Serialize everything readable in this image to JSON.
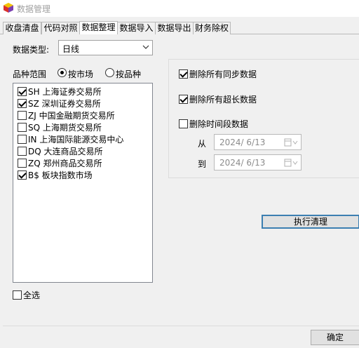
{
  "window": {
    "title": "数据管理"
  },
  "tabs": [
    {
      "label": "收盘清盘",
      "active": false
    },
    {
      "label": "代码对照",
      "active": false
    },
    {
      "label": "数据整理",
      "active": true
    },
    {
      "label": "数据导入",
      "active": false
    },
    {
      "label": "数据导出",
      "active": false
    },
    {
      "label": "财务除权",
      "active": false
    }
  ],
  "data_type": {
    "label": "数据类型:",
    "value": "日线"
  },
  "variety_range": {
    "label": "品种范围",
    "options": [
      {
        "label": "按市场",
        "selected": true
      },
      {
        "label": "按品种",
        "selected": false
      }
    ]
  },
  "markets": [
    {
      "label": "SH 上海证券交易所",
      "checked": true
    },
    {
      "label": "SZ 深圳证券交易所",
      "checked": true
    },
    {
      "label": "ZJ 中国金融期货交易所",
      "checked": false
    },
    {
      "label": "SQ 上海期货交易所",
      "checked": false
    },
    {
      "label": "IN 上海国际能源交易中心",
      "checked": false
    },
    {
      "label": "DQ 大连商品交易所",
      "checked": false
    },
    {
      "label": "ZQ 郑州商品交易所",
      "checked": false
    },
    {
      "label": "B$ 板块指数市场",
      "checked": true
    }
  ],
  "select_all": {
    "label": "全选",
    "checked": false
  },
  "cleanup_options": {
    "delete_sync": {
      "label": "删除所有同步数据",
      "checked": true
    },
    "delete_overlong": {
      "label": "删除所有超长数据",
      "checked": true
    },
    "delete_period": {
      "label": "删除时间段数据",
      "checked": false
    }
  },
  "date_range": {
    "from_label": "从",
    "from_value": "2024/ 6/13",
    "to_label": "到",
    "to_value": "2024/ 6/13"
  },
  "buttons": {
    "execute": "执行清理",
    "ok": "确定"
  },
  "colors": {
    "window_bg": "#f0f0f0",
    "focus_border": "#3c7fb1",
    "disabled_text": "#8c8c8c"
  }
}
